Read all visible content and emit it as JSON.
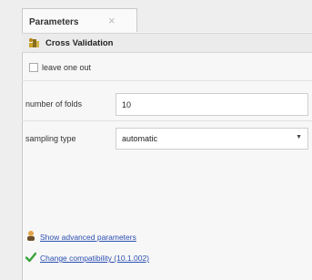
{
  "tab": {
    "label": "Parameters",
    "close_glyph": "×"
  },
  "operator": {
    "name": "Cross Validation",
    "icon": "cross-validation-icon"
  },
  "leave_one_out": {
    "label": "leave one out",
    "checked": false
  },
  "number_of_folds": {
    "label": "number of folds",
    "value": "10"
  },
  "sampling_type": {
    "label": "sampling type",
    "value": "automatic"
  },
  "links": {
    "advanced": "Show advanced parameters",
    "compatibility": "Change compatibility (10.1.002)"
  },
  "colors": {
    "link": "#2c4fb2",
    "check": "#3aa33a"
  }
}
